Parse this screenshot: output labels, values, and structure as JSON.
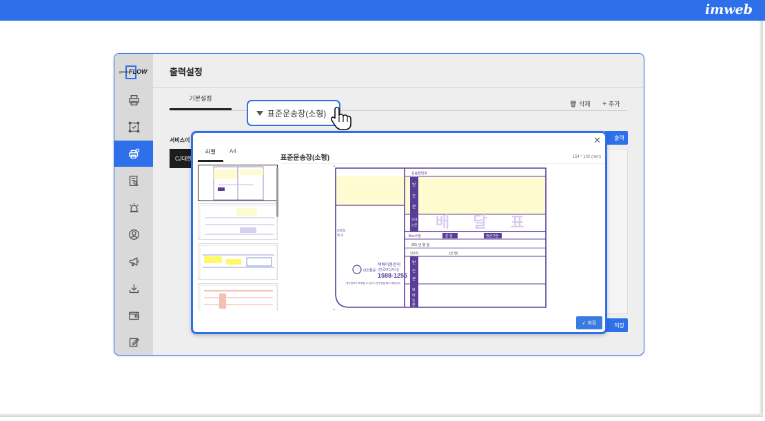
{
  "brand": "imweb",
  "app": {
    "logo": {
      "prefix": "goods",
      "name": "FLOW"
    },
    "sidebar": {
      "items": [
        {
          "icon": "printer-icon"
        },
        {
          "icon": "scan-frame-icon"
        },
        {
          "icon": "print-settings-icon",
          "active": true
        },
        {
          "icon": "document-search-icon"
        },
        {
          "icon": "alarm-light-icon"
        },
        {
          "icon": "user-circle-icon"
        },
        {
          "icon": "megaphone-icon"
        },
        {
          "icon": "download-icon"
        },
        {
          "icon": "wallet-icon"
        },
        {
          "icon": "edit-icon"
        }
      ]
    },
    "header": {
      "title": "출력설정"
    },
    "tabs": [
      {
        "label": "기본설정",
        "active": true
      }
    ],
    "actions": {
      "delete_label": "삭제",
      "add_label": "추가"
    },
    "service_label": "서비스이",
    "carrier_chip": "CJ대한",
    "print_button": "출력",
    "save_button": "저장"
  },
  "dropdown": {
    "selected": "표준운송장(소형)"
  },
  "modal": {
    "tabs": [
      {
        "label": "라벨",
        "active": true
      },
      {
        "label": "A4"
      }
    ],
    "title": "표준운송장(소형)",
    "size_text": "154 * 102 (mm)",
    "save_button": "저장",
    "waybill": {
      "header_label": "운송장번호",
      "recv_chars": [
        "받",
        "는",
        "분"
      ],
      "send_chars": [
        "보",
        "내",
        "는",
        "분"
      ],
      "mid_labels": [
        "받",
        "는",
        "분"
      ],
      "big_title": "배 달 표",
      "left_vertical": "운송장\n번 호",
      "box_label": "Box수량",
      "fare_label": "운 임",
      "payment_label": "정산구분",
      "date_text": "201    년    월    일",
      "seal_text": "(인 명)",
      "receiver_label": "인수자",
      "brand_kor": "대한통운",
      "tagline": "택배이용문의",
      "tagline_sub": "(전국어디서나)",
      "phone": "1588-1255",
      "notice": "개인정보가 포함될 수 있으니 운송장을 폐기 바랍니다."
    }
  },
  "colors": {
    "accent": "#2e6fea",
    "waybill_purple": "#5a3d98",
    "waybill_yellow": "#fffbd0"
  }
}
